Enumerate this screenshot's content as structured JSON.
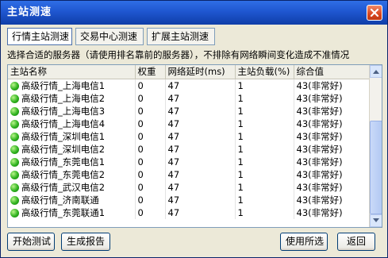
{
  "window": {
    "title": "主站测速"
  },
  "tabs": [
    {
      "label": "行情主站测速",
      "active": true
    },
    {
      "label": "交易中心测速",
      "active": false
    },
    {
      "label": "扩展主站测速",
      "active": false
    }
  ],
  "hint": "选择合适的服务器（请使用排名靠前的服务器），不排除有网络瞬间变化造成不准情况",
  "table": {
    "headers": [
      "主站名称",
      "权重",
      "网络延时(ms)",
      "主站负载(%)",
      "综合值"
    ],
    "rows": [
      {
        "name": "高级行情_上海电信1",
        "weight": "0",
        "latency": "47",
        "load": "1",
        "score": "43(非常好)",
        "status_color": "#2fb21f"
      },
      {
        "name": "高级行情_上海电信2",
        "weight": "0",
        "latency": "47",
        "load": "1",
        "score": "43(非常好)",
        "status_color": "#2fb21f"
      },
      {
        "name": "高级行情_上海电信3",
        "weight": "0",
        "latency": "47",
        "load": "1",
        "score": "43(非常好)",
        "status_color": "#2fb21f"
      },
      {
        "name": "高级行情_上海电信4",
        "weight": "0",
        "latency": "47",
        "load": "1",
        "score": "43(非常好)",
        "status_color": "#2fb21f"
      },
      {
        "name": "高级行情_深圳电信1",
        "weight": "0",
        "latency": "47",
        "load": "1",
        "score": "43(非常好)",
        "status_color": "#2fb21f"
      },
      {
        "name": "高级行情_深圳电信2",
        "weight": "0",
        "latency": "47",
        "load": "1",
        "score": "43(非常好)",
        "status_color": "#2fb21f"
      },
      {
        "name": "高级行情_东莞电信1",
        "weight": "0",
        "latency": "47",
        "load": "1",
        "score": "43(非常好)",
        "status_color": "#2fb21f"
      },
      {
        "name": "高级行情_东莞电信2",
        "weight": "0",
        "latency": "47",
        "load": "1",
        "score": "43(非常好)",
        "status_color": "#2fb21f"
      },
      {
        "name": "高级行情_武汉电信2",
        "weight": "0",
        "latency": "47",
        "load": "1",
        "score": "43(非常好)",
        "status_color": "#2fb21f"
      },
      {
        "name": "高级行情_济南联通",
        "weight": "0",
        "latency": "47",
        "load": "1",
        "score": "43(非常好)",
        "status_color": "#2fb21f"
      },
      {
        "name": "高级行情_东莞联通1",
        "weight": "0",
        "latency": "47",
        "load": "1",
        "score": "43(非常好)",
        "status_color": "#2fb21f"
      }
    ]
  },
  "buttons": {
    "start": "开始测试",
    "report": "生成报告",
    "use_selected": "使用所选",
    "back": "返回"
  },
  "colors": {
    "titlebar": "#1f56d0",
    "window_bg": "#ece9d8",
    "status_good": "#2fb21f"
  },
  "icons": {
    "close": "close-icon",
    "status": "green-status-dot-icon",
    "scroll_up": "chevron-up-icon",
    "scroll_down": "chevron-down-icon"
  }
}
